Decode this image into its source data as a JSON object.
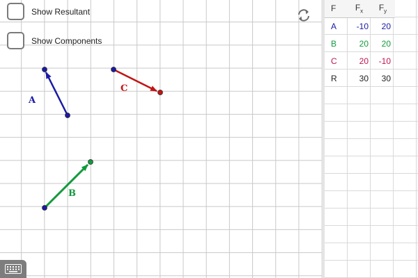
{
  "checkboxes": {
    "show_resultant": {
      "label": "Show Resultant",
      "checked": false
    },
    "show_components": {
      "label": "Show Components",
      "checked": false
    }
  },
  "vectors": [
    {
      "name": "A",
      "color": "#1a1aa6"
    },
    {
      "name": "B",
      "color": "#129a3c"
    },
    {
      "name": "C",
      "color": "#c21414"
    }
  ],
  "table": {
    "headers": {
      "f": "F",
      "fx": "F",
      "fx_sub": "x",
      "fy": "F",
      "fy_sub": "y"
    },
    "rows": [
      {
        "f": "A",
        "fx": "-10",
        "fy": "20",
        "color": "#1a1aa6"
      },
      {
        "f": "B",
        "fx": "20",
        "fy": "20",
        "color": "#129a3c"
      },
      {
        "f": "C",
        "fx": "20",
        "fy": "-10",
        "color": "#c21414"
      },
      {
        "f": "R",
        "fx": "30",
        "fy": "30",
        "color": "#222222"
      }
    ]
  },
  "icons": {
    "reset": "reset-icon",
    "keyboard": "keyboard-icon"
  }
}
